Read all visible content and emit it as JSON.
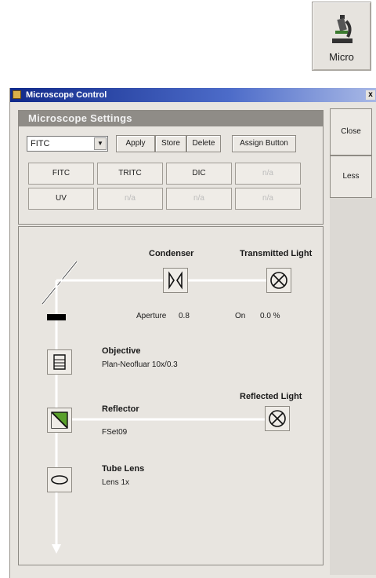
{
  "toolbar": {
    "micro_label": "Micro"
  },
  "window": {
    "title": "Microscope Control",
    "close_glyph": "x"
  },
  "settings": {
    "header": "Microscope Settings",
    "selected_config": "FITC",
    "apply_label": "Apply",
    "store_label": "Store",
    "delete_label": "Delete",
    "assign_label": "Assign Button",
    "row1": [
      "FITC",
      "TRITC",
      "DIC",
      "n/a"
    ],
    "row2": [
      "UV",
      "n/a",
      "n/a",
      "n/a"
    ]
  },
  "side_tabs": {
    "close_label": "Close",
    "less_label": "Less"
  },
  "diagram": {
    "condenser_label": "Condenser",
    "transmitted_label": "Transmitted Light",
    "aperture_label": "Aperture",
    "aperture_value": "0.8",
    "transmitted_state": "On",
    "transmitted_value": "0.0 %",
    "objective_label": "Objective",
    "objective_value": "Plan-Neofluar 10x/0.3",
    "reflected_label": "Reflected Light",
    "reflector_label": "Reflector",
    "reflector_value": "FSet09",
    "tube_lens_label": "Tube Lens",
    "tube_lens_value": "Lens 1x"
  }
}
